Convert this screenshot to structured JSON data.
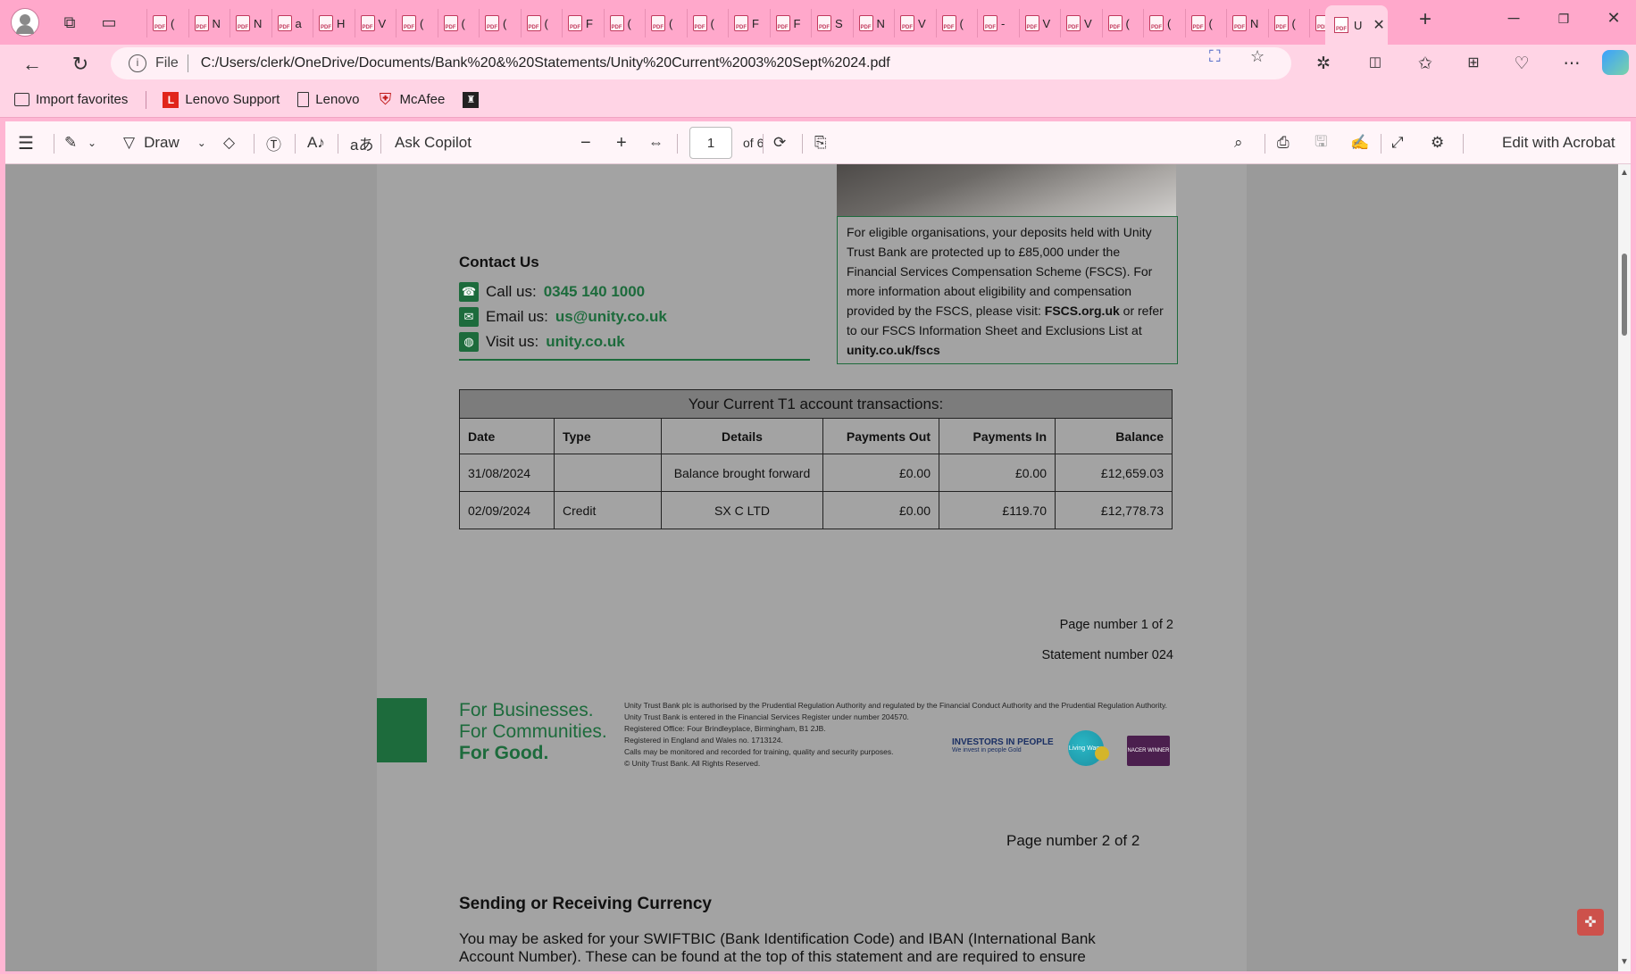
{
  "browser": {
    "tabs_glyphs": [
      "(",
      "N",
      "N",
      "a",
      "H",
      "V",
      "(",
      "(",
      "(",
      "(",
      "F",
      "(",
      "(",
      "(",
      "F",
      "F",
      "S",
      "N",
      "V",
      "(",
      "-",
      "V",
      "V",
      "(",
      "(",
      "(",
      "N",
      "(",
      "("
    ],
    "tab_pdf_label": "PDF",
    "active_tab_text": "U",
    "new_tab": "+",
    "address": {
      "scheme_label": "File",
      "url": "C:/Users/clerk/OneDrive/Documents/Bank%20&%20Statements/Unity%20Current%2003%20Sept%2024.pdf"
    },
    "bookmarks": [
      {
        "label": "Import favorites",
        "icon": "import-icon"
      },
      {
        "label": "Lenovo Support",
        "icon": "lenovo-icon"
      },
      {
        "label": "Lenovo",
        "icon": "page-icon"
      },
      {
        "label": "McAfee",
        "icon": "mcafee-icon"
      }
    ]
  },
  "pdf_toolbar": {
    "draw_label": "Draw",
    "ask_copilot": "Ask Copilot",
    "page_current": "1",
    "page_total": "of 6",
    "edit_acrobat": "Edit with Acrobat"
  },
  "statement": {
    "fscs_text_1": "For eligible organisations, your deposits held with Unity Trust Bank are protected up to £85,000 under the Financial Services Compensation Scheme (FSCS). For more information about eligibility and compensation provided by the FSCS, please visit: ",
    "fscs_link_1": "FSCS.org.uk",
    "fscs_text_2": " or refer to our FSCS Information Sheet and Exclusions List at ",
    "fscs_link_2": "unity.co.uk/fscs",
    "contact": {
      "title": "Contact Us",
      "call_label": "Call us:",
      "call_value": "0345 140 1000",
      "email_label": "Email us:",
      "email_value": "us@unity.co.uk",
      "visit_label": "Visit us:",
      "visit_value": "unity.co.uk"
    },
    "table": {
      "caption": "Your Current T1 account transactions:",
      "headers": [
        "Date",
        "Type",
        "Details",
        "Payments Out",
        "Payments In",
        "Balance"
      ],
      "rows": [
        [
          "31/08/2024",
          "",
          "Balance brought forward",
          "£0.00",
          "£0.00",
          "£12,659.03"
        ],
        [
          "02/09/2024",
          "Credit",
          "SX C LTD",
          "£0.00",
          "£119.70",
          "£12,778.73"
        ]
      ]
    },
    "page_number": "Page number 1 of 2",
    "statement_number": "Statement number 024",
    "slogan": [
      "For Businesses.",
      "For Communities.",
      "For Good."
    ],
    "legal_lines": [
      "Unity Trust Bank plc is authorised by the Prudential Regulation Authority and regulated by the Financial Conduct Authority and the Prudential Regulation Authority.",
      "Unity Trust Bank is entered in the Financial Services Register under number 204570.",
      "Registered Office: Four Brindleyplace, Birmingham, B1 2JB.",
      "Registered in England and Wales no. 1713124.",
      "Calls may be monitored and recorded for training, quality and security purposes.",
      "© Unity Trust Bank. All Rights Reserved."
    ],
    "logos": {
      "iip": "INVESTORS IN PEOPLE",
      "iip_sub": "We invest in people  Gold",
      "living_wage": "Living Wage",
      "nacer": "NACER WINNER"
    }
  },
  "page2": {
    "page_number": "Page number 2 of 2",
    "heading": "Sending or Receiving Currency",
    "paragraph": "You may be asked for your SWIFTBIC (Bank Identification Code) and IBAN (International Bank Account Number). These can be found at the top of this statement and are required to ensure"
  },
  "colors": {
    "brand_green": "#1d6b3c",
    "theme_pink": "#ffa8cb"
  }
}
